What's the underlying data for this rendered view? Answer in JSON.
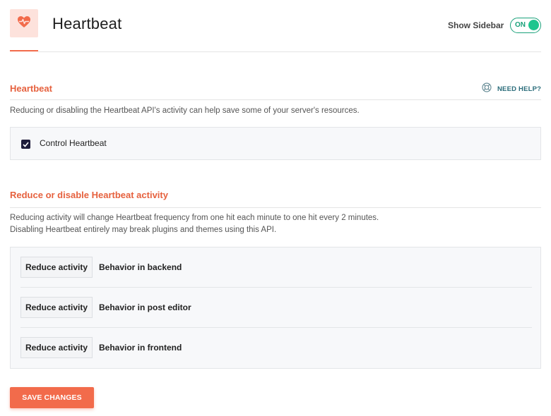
{
  "header": {
    "icon": "heartbeat-icon",
    "title": "Heartbeat",
    "sidebar_toggle_label": "Show Sidebar",
    "sidebar_toggle_state": "ON",
    "accent_color": "#f26b4b",
    "toggle_color": "#1ec58e"
  },
  "section_heartbeat": {
    "title": "Heartbeat",
    "help_link": "NEED HELP?",
    "help_icon": "lifebuoy-icon",
    "description": "Reducing or disabling the Heartbeat API's activity can help save some of your server's resources.",
    "control_label": "Control Heartbeat",
    "control_checked": true
  },
  "section_reduce": {
    "title": "Reduce or disable Heartbeat activity",
    "description_line1": "Reducing activity will change Heartbeat frequency from one hit each minute to one hit every 2 minutes.",
    "description_line2": "Disabling Heartbeat entirely may break plugins and themes using this API.",
    "rows": [
      {
        "select_value": "Reduce activity",
        "label": "Behavior in backend"
      },
      {
        "select_value": "Reduce activity",
        "label": "Behavior in post editor"
      },
      {
        "select_value": "Reduce activity",
        "label": "Behavior in frontend"
      }
    ]
  },
  "footer": {
    "save_label": "SAVE CHANGES"
  }
}
